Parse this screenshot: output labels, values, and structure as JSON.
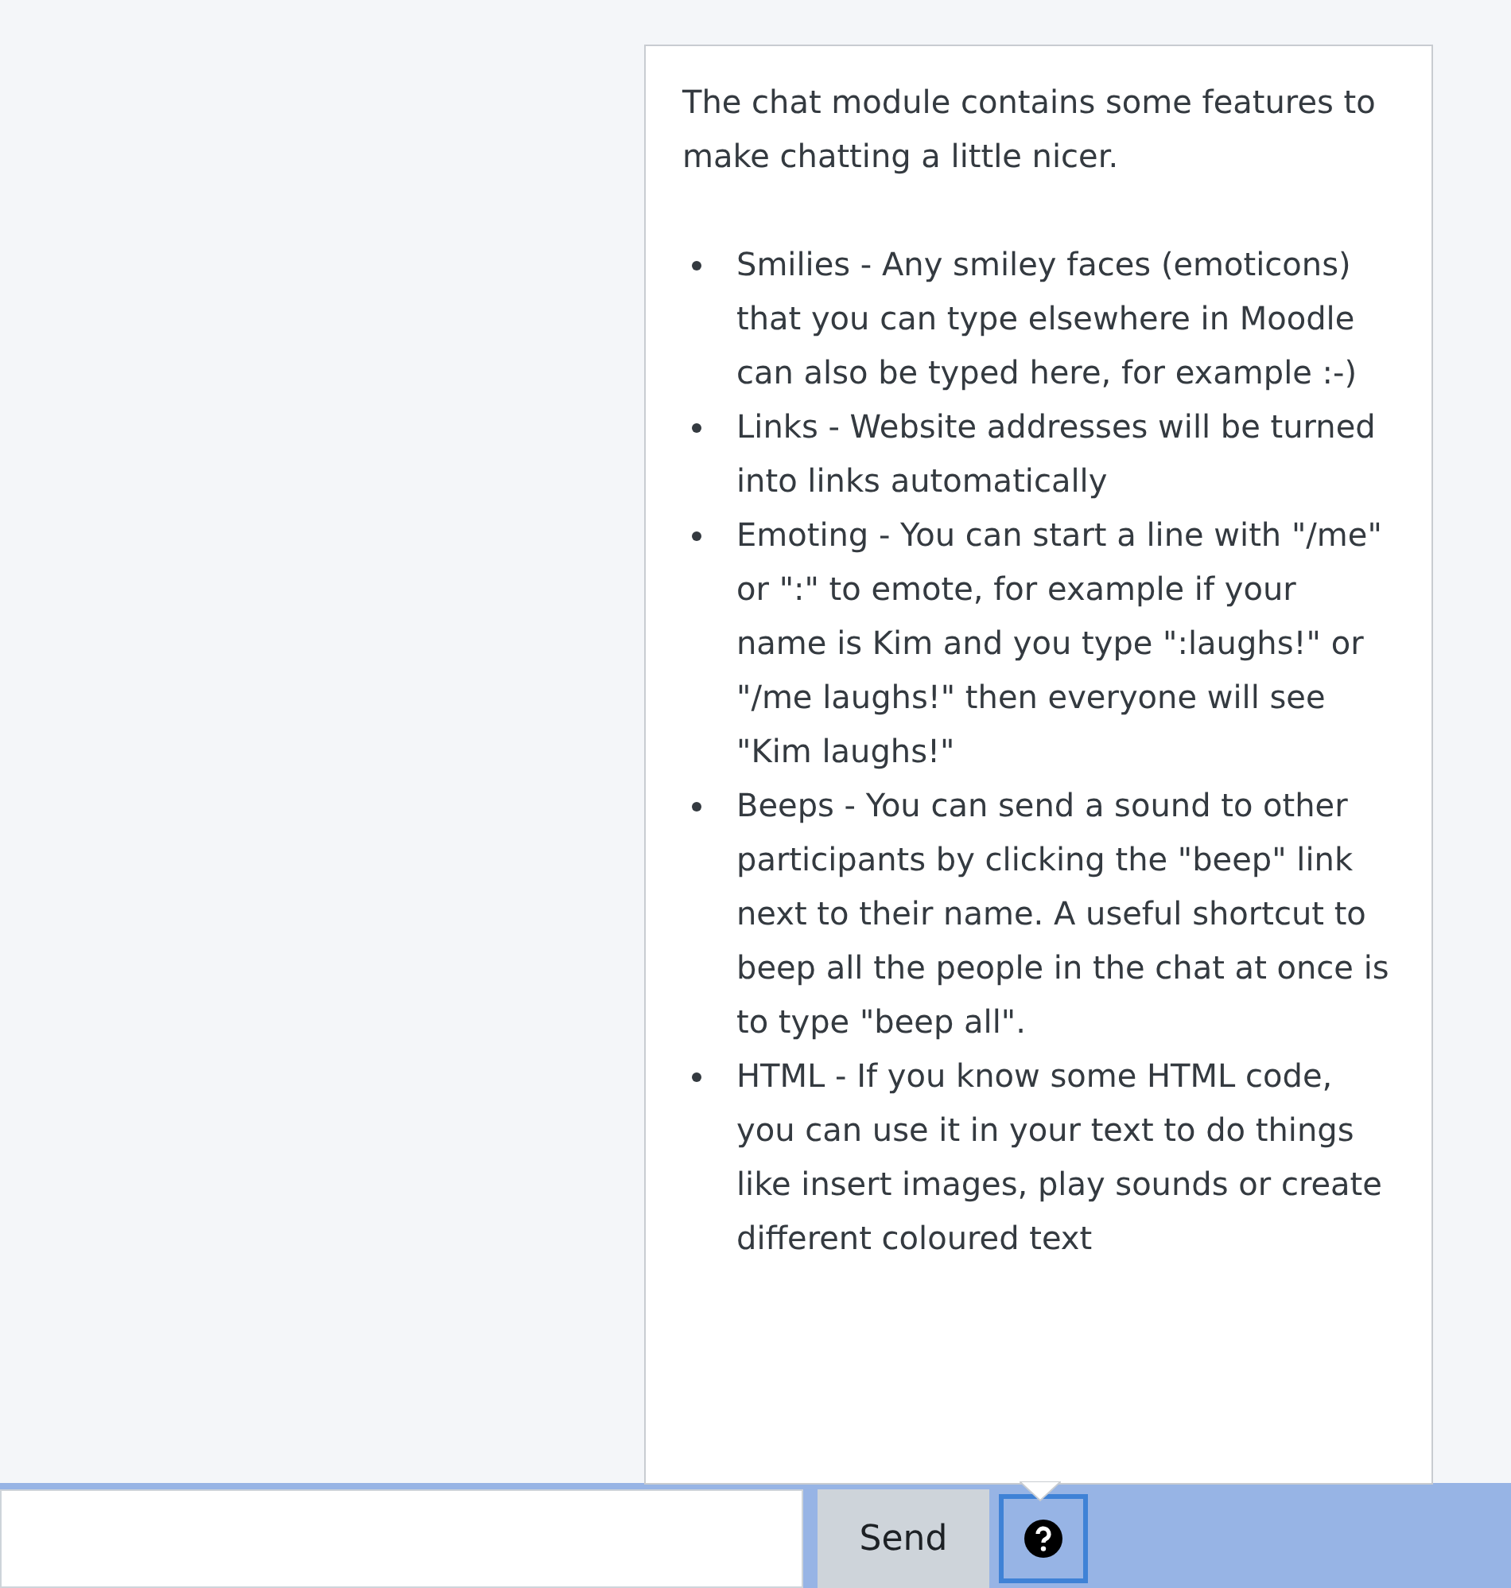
{
  "help_popover": {
    "intro": "The chat module contains some features to make chatting a little nicer.",
    "items": [
      "Smilies - Any smiley faces (emoticons) that you can type elsewhere in Moodle can also be typed here, for example :-)",
      "Links - Website addresses will be turned into links automatically",
      "Emoting - You can start a line with \"/me\" or \":\" to emote, for example if your name is Kim and you type \":laughs!\" or \"/me laughs!\" then everyone will see \"Kim laughs!\"",
      "Beeps - You can send a sound to other participants by clicking the \"beep\" link next to their name. A useful shortcut to beep all the people in the chat at once is to type \"beep all\".",
      "HTML - If you know some HTML code, you can use it in your text to do things like insert images, play sounds or create different coloured text"
    ]
  },
  "send_button": "Send"
}
